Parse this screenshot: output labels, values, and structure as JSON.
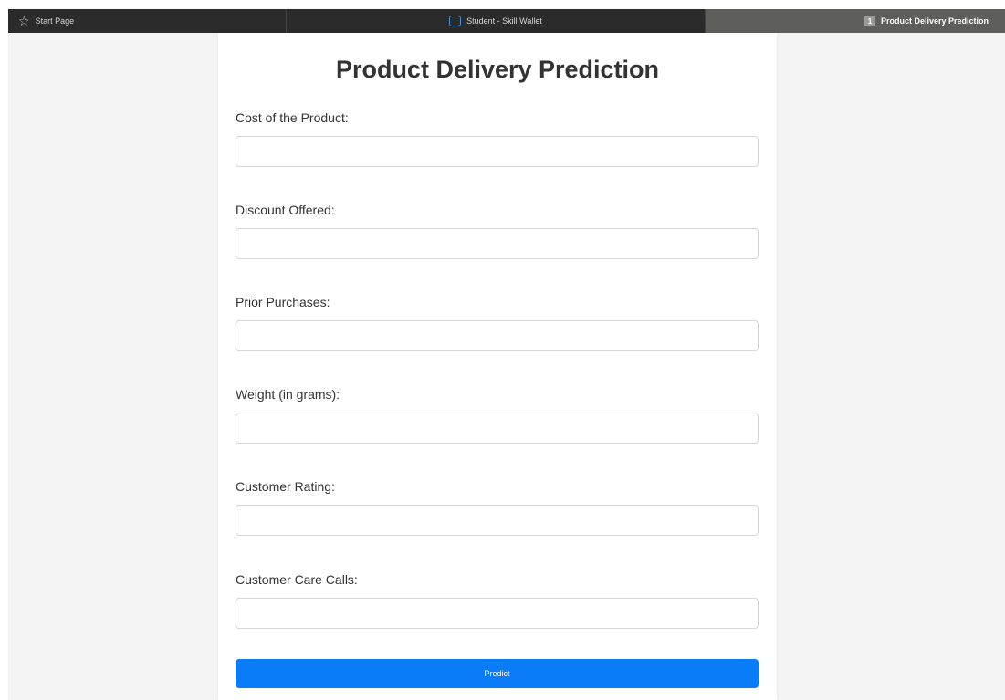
{
  "browser": {
    "tabs": [
      {
        "label": "Start Page",
        "icon": "star-icon"
      },
      {
        "label": "Student - Skill Wallet",
        "icon": "wallet-icon"
      },
      {
        "label": "Product Delivery Prediction",
        "badge": "1",
        "active": true
      }
    ]
  },
  "form": {
    "title": "Product Delivery Prediction",
    "fields": [
      {
        "label": "Cost of the Product:",
        "value": "",
        "placeholder": ""
      },
      {
        "label": "Discount Offered:",
        "value": "",
        "placeholder": ""
      },
      {
        "label": "Prior Purchases:",
        "value": "",
        "placeholder": ""
      },
      {
        "label": "Weight (in grams):",
        "value": "",
        "placeholder": ""
      },
      {
        "label": "Customer Rating:",
        "value": "",
        "placeholder": ""
      },
      {
        "label": "Customer Care Calls:",
        "value": "",
        "placeholder": ""
      }
    ],
    "submit_label": "Predict"
  },
  "colors": {
    "accent": "#0a7cf7",
    "tabbar": "#2b2b2b",
    "active_tab": "#5e5e5a",
    "page_background": "#f4f4f4"
  }
}
